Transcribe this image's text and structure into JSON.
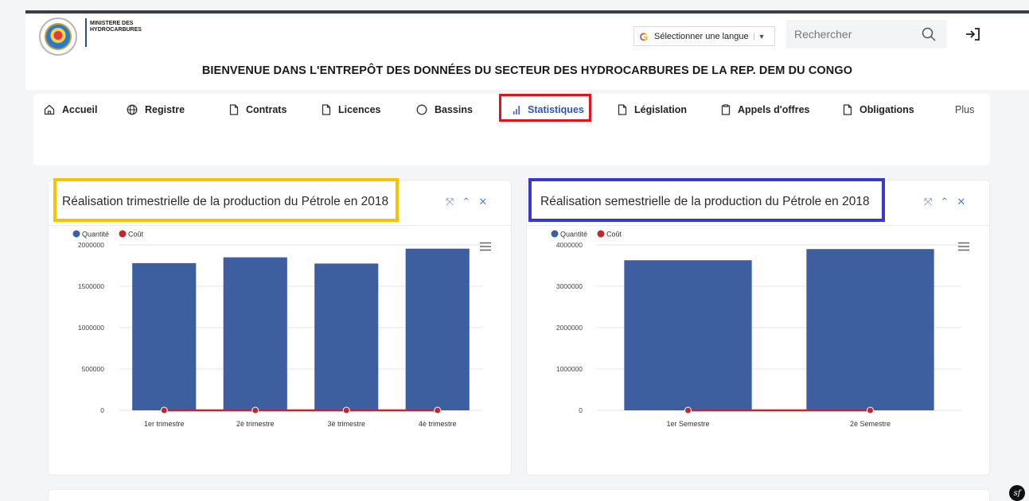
{
  "header": {
    "ministry_line1": "MINISTERE DES",
    "ministry_line2": "HYDROCARBURES",
    "language_selector": "Sélectionner une langue",
    "search_placeholder": "Rechercher",
    "welcome": "BIENVENUE DANS L'ENTREPÔT DES DONNÉES DU SECTEUR DES HYDROCARBURES DE LA REP. DEM DU CONGO"
  },
  "nav": {
    "items": [
      {
        "label": "Accueil",
        "icon": "home-icon"
      },
      {
        "label": "Registre",
        "icon": "globe-icon"
      },
      {
        "label": "Contrats",
        "icon": "document-icon"
      },
      {
        "label": "Licences",
        "icon": "document-icon"
      },
      {
        "label": "Bassins",
        "icon": "circle-icon"
      },
      {
        "label": "Statistiques",
        "icon": "bar-chart-icon",
        "active": true
      },
      {
        "label": "Législation",
        "icon": "document-icon"
      },
      {
        "label": "Appels d'offres",
        "icon": "clipboard-icon"
      },
      {
        "label": "Obligations",
        "icon": "document-icon"
      },
      {
        "label": "Plus"
      }
    ]
  },
  "colors": {
    "quantity": "#3d5f9f",
    "cost": "#c0282d",
    "highlight_red": "#e3121b",
    "highlight_yellow": "#f7c200",
    "highlight_blue": "#3b39c9"
  },
  "chart_data": [
    {
      "type": "bar",
      "title": "Réalisation trimestrielle de la production du Pétrole en 2018",
      "categories": [
        "1er trimestre",
        "2è trimestre",
        "3è trimestre",
        "4è trimestre"
      ],
      "series": [
        {
          "name": "Quantité",
          "type": "bar",
          "values": [
            1780000,
            1850000,
            1775000,
            1955000
          ]
        },
        {
          "name": "Coût",
          "type": "line",
          "values": [
            0,
            0,
            0,
            0
          ]
        }
      ],
      "y_ticks": [
        "0",
        "500000",
        "1000000",
        "1500000",
        "2000000"
      ],
      "ylim": [
        0,
        2000000
      ],
      "legend": "top-left",
      "grid": true
    },
    {
      "type": "bar",
      "title": "Réalisation semestrielle de la production du Pétrole en 2018",
      "categories": [
        "1er Semestre",
        "2è Semestre"
      ],
      "series": [
        {
          "name": "Quantité",
          "type": "bar",
          "values": [
            3630000,
            3900000
          ]
        },
        {
          "name": "Coût",
          "type": "line",
          "values": [
            0,
            0
          ]
        }
      ],
      "y_ticks": [
        "0",
        "1000000",
        "2000000",
        "3000000",
        "4000000"
      ],
      "ylim": [
        0,
        4000000
      ],
      "legend": "top-left",
      "grid": true
    }
  ]
}
